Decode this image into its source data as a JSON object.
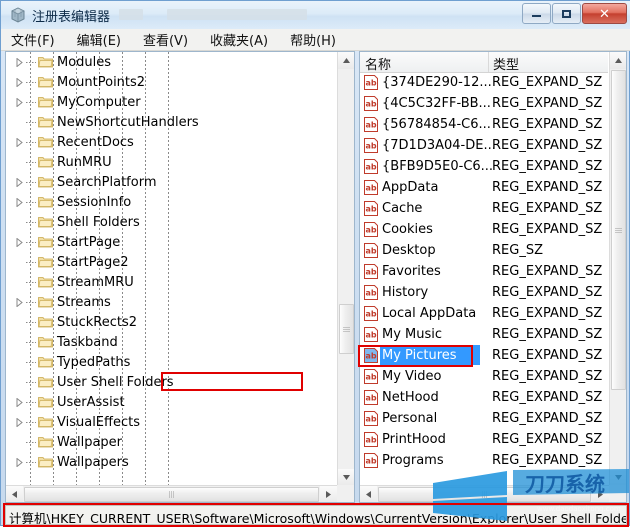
{
  "window": {
    "title": "注册表编辑器",
    "icon": "registry-editor-icon",
    "buttons": {
      "minimize": "—",
      "maximize": "□",
      "close": "✕"
    }
  },
  "menubar": {
    "items": [
      {
        "label": "文件(F)",
        "name": "menu-file"
      },
      {
        "label": "编辑(E)",
        "name": "menu-edit"
      },
      {
        "label": "查看(V)",
        "name": "menu-view"
      },
      {
        "label": "收藏夹(A)",
        "name": "menu-favorites"
      },
      {
        "label": "帮助(H)",
        "name": "menu-help"
      }
    ]
  },
  "tree": {
    "items": [
      {
        "label": "Modules",
        "expandable": true,
        "selected": false
      },
      {
        "label": "MountPoints2",
        "expandable": true,
        "selected": false
      },
      {
        "label": "MyComputer",
        "expandable": true,
        "selected": false
      },
      {
        "label": "NewShortcutHandlers",
        "expandable": false,
        "selected": false
      },
      {
        "label": "RecentDocs",
        "expandable": true,
        "selected": false
      },
      {
        "label": "RunMRU",
        "expandable": false,
        "selected": false
      },
      {
        "label": "SearchPlatform",
        "expandable": true,
        "selected": false
      },
      {
        "label": "SessionInfo",
        "expandable": true,
        "selected": false
      },
      {
        "label": "Shell Folders",
        "expandable": false,
        "selected": false
      },
      {
        "label": "StartPage",
        "expandable": true,
        "selected": false
      },
      {
        "label": "StartPage2",
        "expandable": false,
        "selected": false
      },
      {
        "label": "StreamMRU",
        "expandable": false,
        "selected": false
      },
      {
        "label": "Streams",
        "expandable": true,
        "selected": false
      },
      {
        "label": "StuckRects2",
        "expandable": false,
        "selected": false
      },
      {
        "label": "Taskband",
        "expandable": false,
        "selected": false
      },
      {
        "label": "TypedPaths",
        "expandable": false,
        "selected": false
      },
      {
        "label": "User Shell Folders",
        "expandable": false,
        "selected": false
      },
      {
        "label": "UserAssist",
        "expandable": true,
        "selected": false
      },
      {
        "label": "VisualEffects",
        "expandable": true,
        "selected": false
      },
      {
        "label": "Wallpaper",
        "expandable": false,
        "selected": false
      },
      {
        "label": "Wallpapers",
        "expandable": true,
        "selected": false
      }
    ]
  },
  "list": {
    "columns": [
      {
        "label": "名称",
        "name": "column-name"
      },
      {
        "label": "类型",
        "name": "column-type"
      }
    ],
    "rows": [
      {
        "name": "{374DE290-12...",
        "type": "REG_EXPAND_SZ",
        "selected": false
      },
      {
        "name": "{4C5C32FF-BB...",
        "type": "REG_EXPAND_SZ",
        "selected": false
      },
      {
        "name": "{56784854-C6...",
        "type": "REG_EXPAND_SZ",
        "selected": false
      },
      {
        "name": "{7D1D3A04-DE...",
        "type": "REG_EXPAND_SZ",
        "selected": false
      },
      {
        "name": "{BFB9D5E0-C6...",
        "type": "REG_EXPAND_SZ",
        "selected": false
      },
      {
        "name": "AppData",
        "type": "REG_EXPAND_SZ",
        "selected": false
      },
      {
        "name": "Cache",
        "type": "REG_EXPAND_SZ",
        "selected": false
      },
      {
        "name": "Cookies",
        "type": "REG_EXPAND_SZ",
        "selected": false
      },
      {
        "name": "Desktop",
        "type": "REG_SZ",
        "selected": false
      },
      {
        "name": "Favorites",
        "type": "REG_EXPAND_SZ",
        "selected": false
      },
      {
        "name": "History",
        "type": "REG_EXPAND_SZ",
        "selected": false
      },
      {
        "name": "Local AppData",
        "type": "REG_EXPAND_SZ",
        "selected": false
      },
      {
        "name": "My Music",
        "type": "REG_EXPAND_SZ",
        "selected": false
      },
      {
        "name": "My Pictures",
        "type": "REG_EXPAND_SZ",
        "selected": true
      },
      {
        "name": "My Video",
        "type": "REG_EXPAND_SZ",
        "selected": false
      },
      {
        "name": "NetHood",
        "type": "REG_EXPAND_SZ",
        "selected": false
      },
      {
        "name": "Personal",
        "type": "REG_EXPAND_SZ",
        "selected": false
      },
      {
        "name": "PrintHood",
        "type": "REG_EXPAND_SZ",
        "selected": false
      },
      {
        "name": "Programs",
        "type": "REG_EXPAND_SZ",
        "selected": false
      }
    ]
  },
  "statusbar": {
    "path": "计算机\\HKEY_CURRENT_USER\\Software\\Microsoft\\Windows\\CurrentVersion\\Explorer\\User Shell Folders"
  },
  "annotations": {
    "color": "#e00000",
    "items": [
      {
        "name": "tree-key-highlight",
        "target": "User Shell Folders"
      },
      {
        "name": "value-highlight",
        "target": "My Pictures"
      },
      {
        "name": "status-path-highlight",
        "target": "registry path"
      }
    ]
  },
  "watermark": {
    "text": "刀刀系统",
    "color": "#1f8fd6"
  }
}
